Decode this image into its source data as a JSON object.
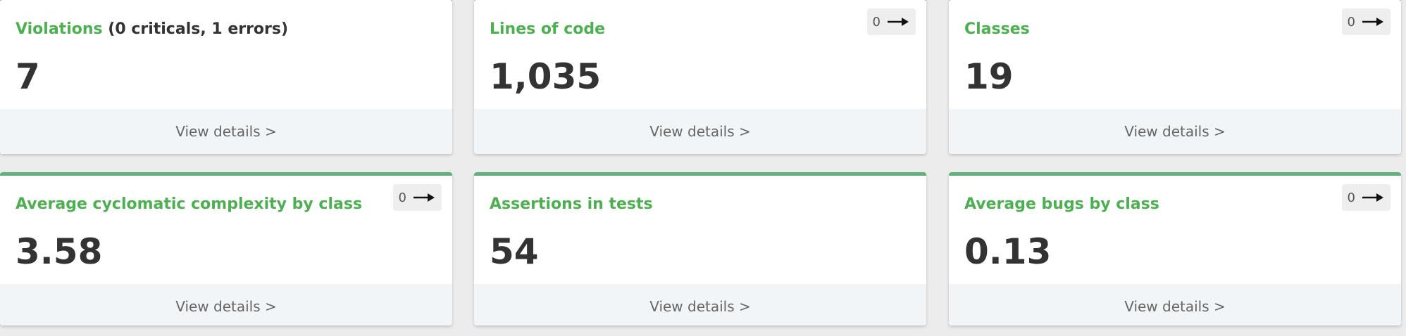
{
  "cards": [
    {
      "title": "Violations",
      "title_extra": "(0 criticals, 1 errors)",
      "value": "7",
      "footer": "View details >"
    },
    {
      "title": "Lines of code",
      "value": "1,035",
      "trend": "0",
      "trend_icon": "arrow-right-icon",
      "footer": "View details >"
    },
    {
      "title": "Classes",
      "value": "19",
      "trend": "0",
      "trend_icon": "arrow-right-icon",
      "footer": "View details >"
    },
    {
      "title": "Average cyclomatic complexity by class",
      "value": "3.58",
      "trend": "0",
      "trend_icon": "arrow-right-icon",
      "footer": "View details >"
    },
    {
      "title": "Assertions in tests",
      "value": "54",
      "footer": "View details >"
    },
    {
      "title": "Average bugs by class",
      "value": "0.13",
      "trend": "0",
      "trend_icon": "arrow-right-icon",
      "footer": "View details >"
    }
  ],
  "colors": {
    "accent": "#4caf50",
    "card_top_border": "#5fb37a",
    "value_text": "#333333",
    "footer_bg": "#f1f5f8"
  }
}
